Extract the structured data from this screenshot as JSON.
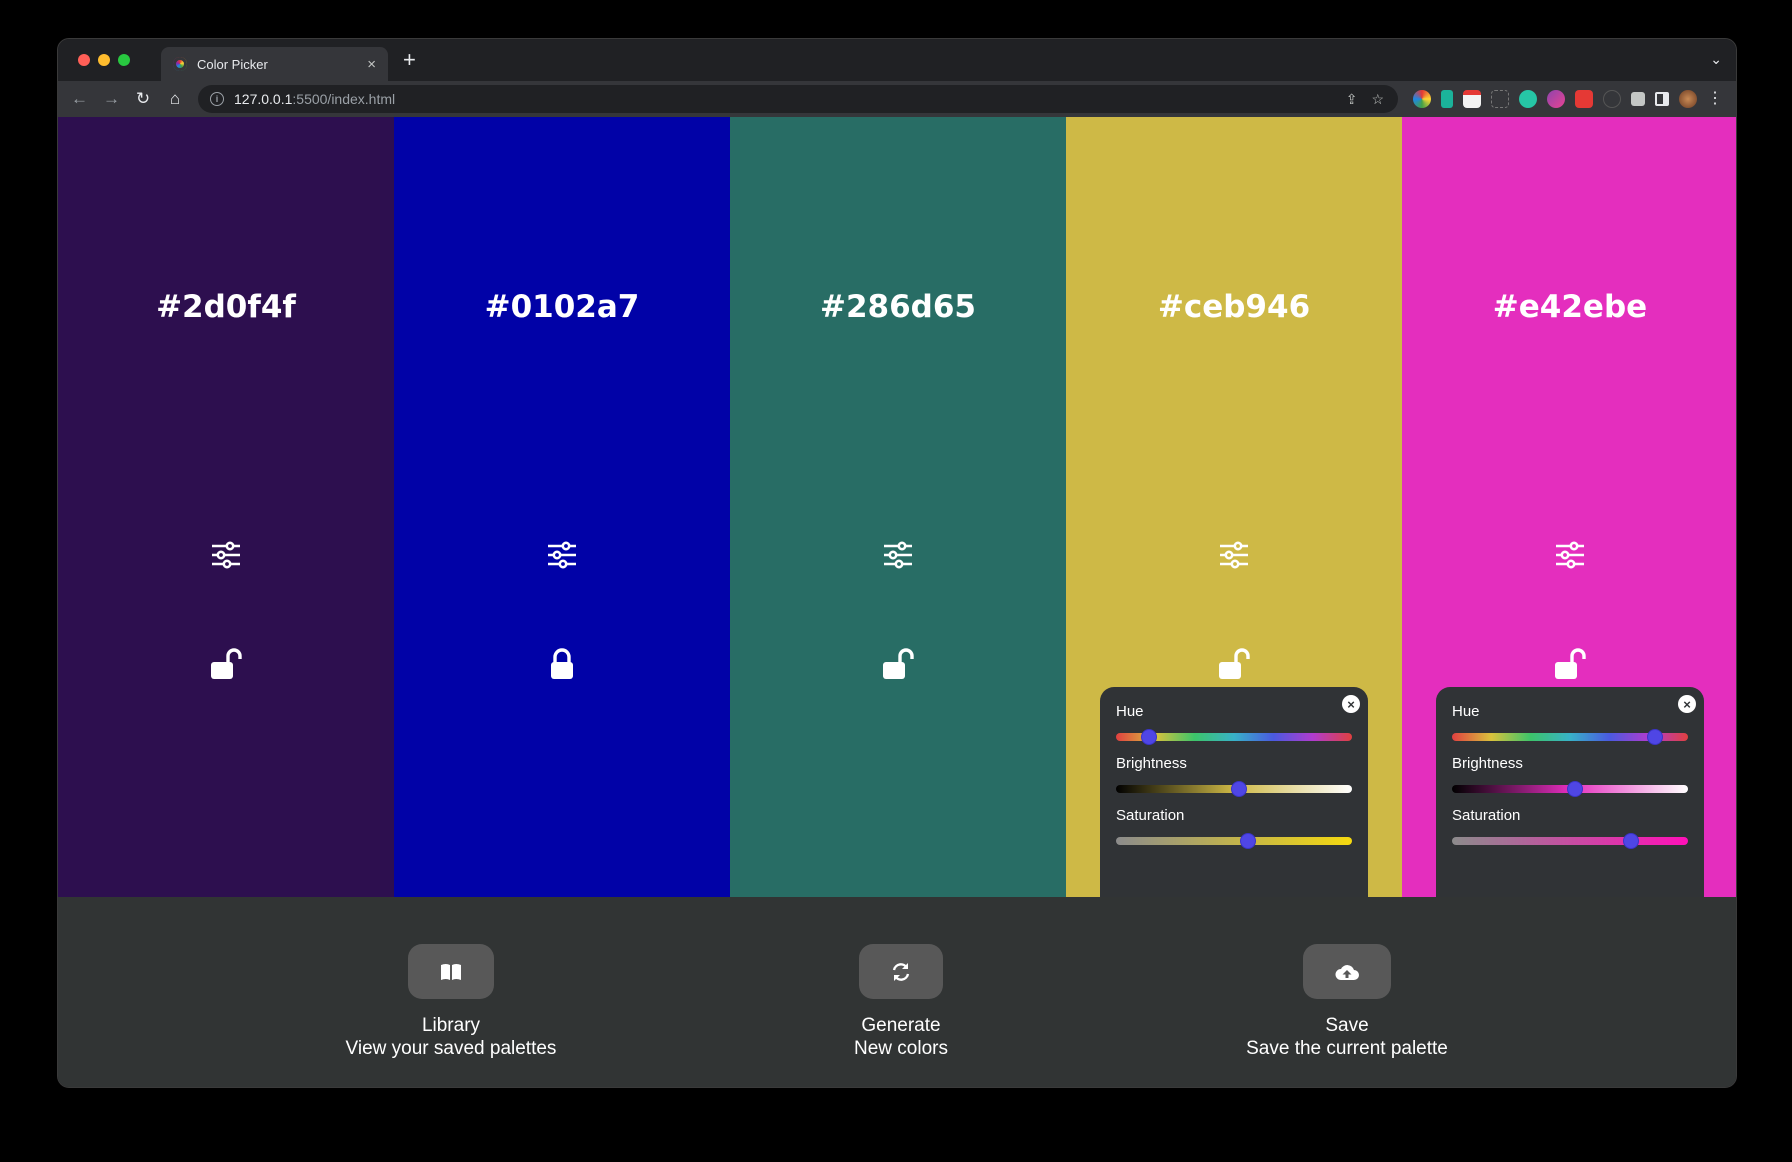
{
  "browser": {
    "tab_title": "Color Picker",
    "tab_close": "×",
    "new_tab": "+",
    "tab_menu": "⌄",
    "url_host": "127.0.0.1",
    "url_path": ":5500/index.html"
  },
  "palette": [
    {
      "hex": "#2d0f4f",
      "bg": "#2d0f4f",
      "locked": false
    },
    {
      "hex": "#0102a7",
      "bg": "#0102a7",
      "locked": true
    },
    {
      "hex": "#286d65",
      "bg": "#286d65",
      "locked": false
    },
    {
      "hex": "#ceb946",
      "bg": "#ceb946",
      "locked": false
    },
    {
      "hex": "#e42ebe",
      "bg": "#e42ebe",
      "locked": false
    }
  ],
  "adjust_panels": [
    {
      "hue_label": "Hue",
      "brightness_label": "Brightness",
      "saturation_label": "Saturation",
      "close": "×",
      "hue": 0.14,
      "brightness": 0.52,
      "saturation": 0.56
    },
    {
      "hue_label": "Hue",
      "brightness_label": "Brightness",
      "saturation_label": "Saturation",
      "close": "×",
      "hue": 0.86,
      "brightness": 0.52,
      "saturation": 0.76
    }
  ],
  "footer": {
    "library_title": "Library",
    "library_sub": "View your saved palettes",
    "generate_title": "Generate",
    "generate_sub": "New colors",
    "save_title": "Save",
    "save_sub": "Save the current palette"
  }
}
